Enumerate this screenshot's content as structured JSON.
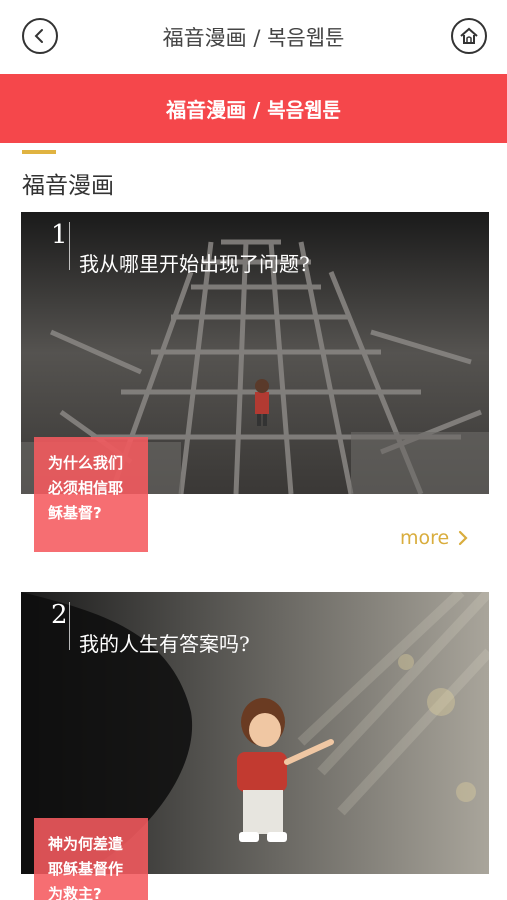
{
  "header": {
    "title": "福音漫画 / 복음웹툰",
    "back_icon": "chevron-left-icon",
    "home_icon": "home-icon"
  },
  "banner": {
    "title": "福音漫画 / 복음웹툰",
    "color": "#f5474b"
  },
  "section": {
    "title": "福音漫画",
    "accent_color": "#e0b341"
  },
  "cards": [
    {
      "number": "1",
      "headline": "我从哪里开始出现了问题?",
      "tag": "为什么我们\n必须相信耶\n稣基督?",
      "more_label": "more"
    },
    {
      "number": "2",
      "headline": "我的人生有答案吗?",
      "tag": "神为何差遣\n耶稣基督作\n为救主?"
    }
  ]
}
